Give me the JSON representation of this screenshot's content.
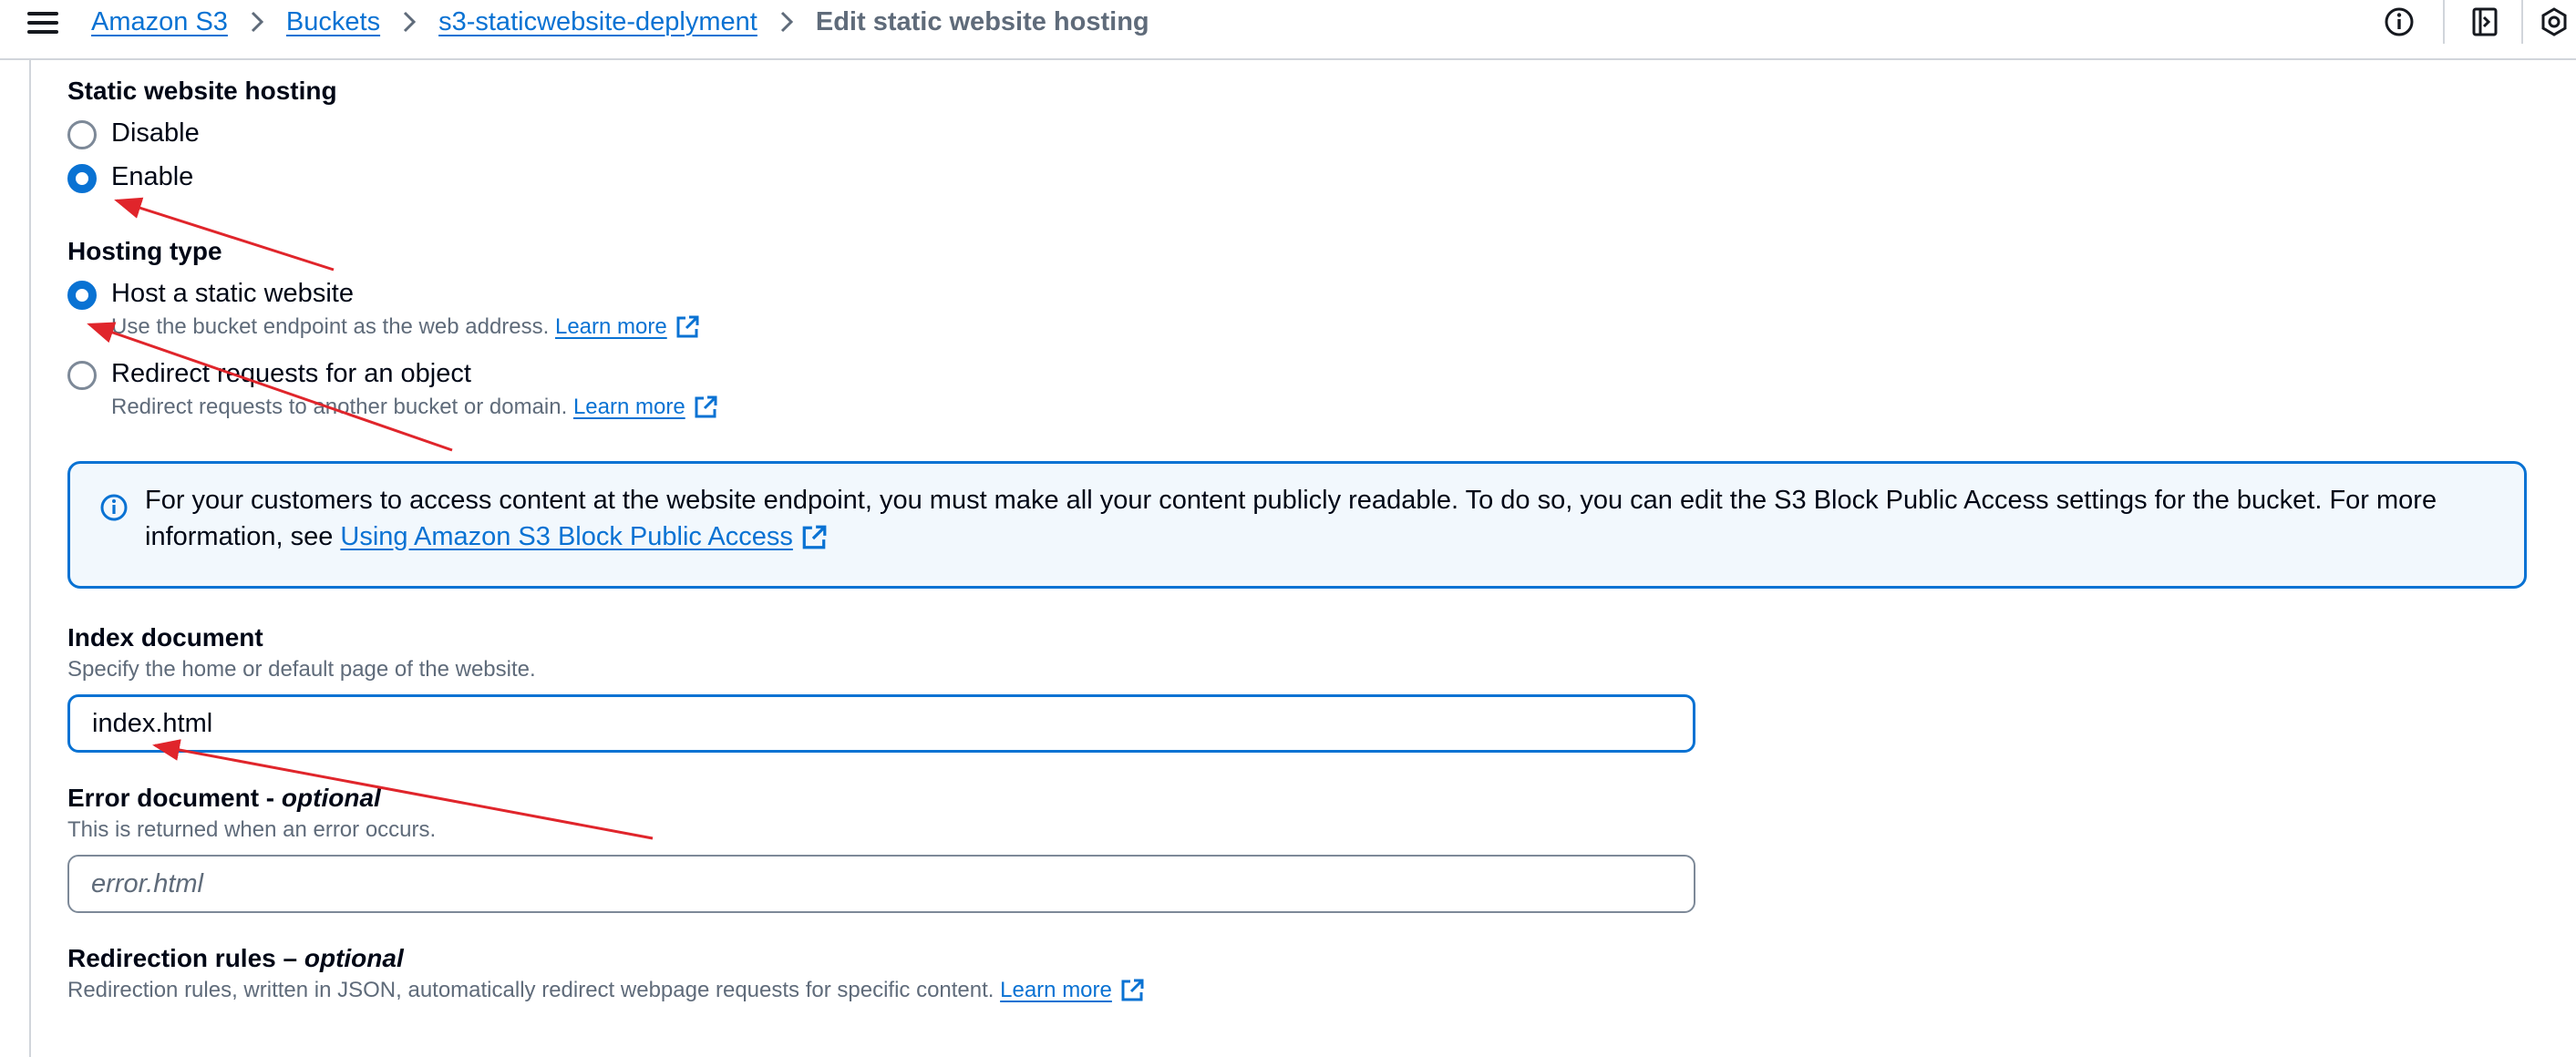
{
  "header": {
    "menu_icon": "hamburger-menu-icon",
    "breadcrumbs": [
      "Amazon S3",
      "Buckets",
      "s3-staticwebsite-deplyment"
    ],
    "current_page": "Edit static website hosting",
    "tools": [
      "info-icon",
      "notes-icon",
      "hexagon-icon"
    ]
  },
  "hosting": {
    "heading": "Static website hosting",
    "options": [
      "Disable",
      "Enable"
    ],
    "selected": "Enable"
  },
  "hosting_type": {
    "heading": "Hosting type",
    "options": [
      {
        "label": "Host a static website",
        "description": "Use the bucket endpoint as the web address.",
        "link": "Learn more"
      },
      {
        "label": "Redirect requests for an object",
        "description": "Redirect requests to another bucket or domain.",
        "link": "Learn more"
      }
    ],
    "selected": "Host a static website"
  },
  "alert": {
    "text": "For your customers to access content at the website endpoint, you must make all your content publicly readable. To do so, you can edit the S3 Block Public Access settings for the bucket. For more information, see",
    "link": "Using Amazon S3 Block Public Access"
  },
  "index_document": {
    "label": "Index document",
    "description": "Specify the home or default page of the website.",
    "value": "index.html"
  },
  "error_document": {
    "label": "Error document -",
    "optional": "optional",
    "description": "This is returned when an error occurs.",
    "placeholder": "error.html"
  },
  "redirection_rules": {
    "label": "Redirection rules –",
    "optional": "optional",
    "description": "Redirection rules, written in JSON, automatically redirect webpage requests for specific content.",
    "link": "Learn more"
  },
  "colors": {
    "link": "#0972d3",
    "alert_background": "#f2f8fd",
    "annotation_arrow": "#e0252b"
  }
}
